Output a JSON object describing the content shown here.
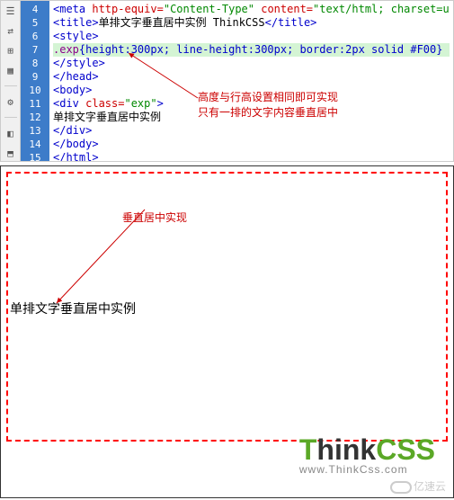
{
  "gutter": [
    "4",
    "5",
    "6",
    "7",
    "8",
    "9",
    "10",
    "11",
    "12",
    "13",
    "14",
    "15"
  ],
  "code": {
    "l4_open": "<meta ",
    "l4_attr": "http-equiv=",
    "l4_val1": "\"Content-Type\"",
    "l4_attr2": " content=",
    "l4_val2": "\"text/html; charset=u",
    "l5_open": "<title>",
    "l5_text": "单排文字垂直居中实例 ThinkCSS",
    "l5_close": "</title>",
    "l6": "<style>",
    "l7_sel": ".exp",
    "l7_rule": "{height:300px; line-height:300px; border:2px solid #F00}",
    "l8": "</style>",
    "l9": "</head>",
    "l10": "<body>",
    "l11_open": "<div ",
    "l11_attr": "class=",
    "l11_val": "\"exp\"",
    "l11_close": ">",
    "l12": "单排文字垂直居中实例",
    "l13": "</div>",
    "l14": "</body>",
    "l15": "</html>"
  },
  "annotations": {
    "note1_line1": "高度与行高设置相同即可实现",
    "note1_line2": "只有一排的文字内容垂直居中",
    "note2": "垂直居中实现"
  },
  "preview": {
    "text": "单排文字垂直居中实例"
  },
  "logo": {
    "t": "T",
    "hink": "hink",
    "css": "CSS",
    "url": "www.ThinkCss.com"
  },
  "watermark": "亿速云",
  "chart_data": null
}
